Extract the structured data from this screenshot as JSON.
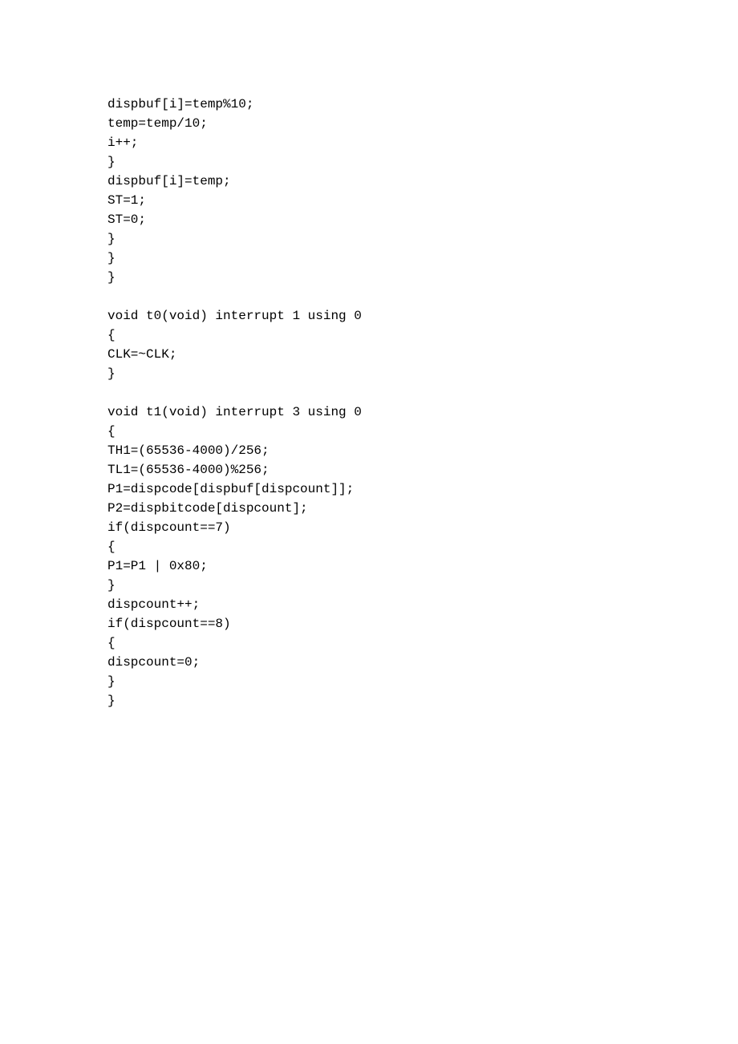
{
  "code": {
    "lines": [
      "dispbuf[i]=temp%10;",
      "temp=temp/10;",
      "i++;",
      "}",
      "dispbuf[i]=temp;",
      "ST=1;",
      "ST=0;",
      "}",
      "}",
      "}",
      "",
      "void t0(void) interrupt 1 using 0",
      "{",
      "CLK=~CLK;",
      "}",
      "",
      "void t1(void) interrupt 3 using 0",
      "{",
      "TH1=(65536-4000)/256;",
      "TL1=(65536-4000)%256;",
      "P1=dispcode[dispbuf[dispcount]];",
      "P2=dispbitcode[dispcount];",
      "if(dispcount==7)",
      "{",
      "P1=P1 | 0x80;",
      "}",
      "dispcount++;",
      "if(dispcount==8)",
      "{",
      "dispcount=0;",
      "}",
      "}"
    ]
  }
}
